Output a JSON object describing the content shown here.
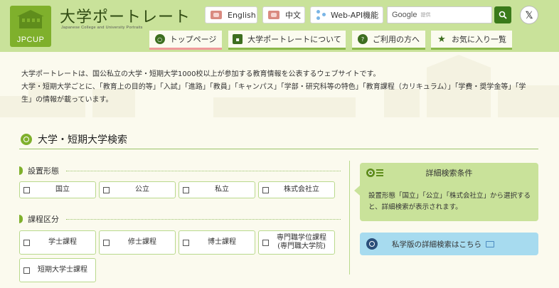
{
  "header": {
    "logo_text": "JPCUP",
    "title": "大学ポートレート",
    "subtitle": "Japanese College and University Portraits",
    "lang_en": "English",
    "lang_zh": "中文",
    "webapi": "Web-API機能",
    "search_brand": "Google",
    "search_placeholder": "提供",
    "x_label": "𝕏"
  },
  "nav": {
    "top": "トップページ",
    "about": "大学ポートレートについて",
    "users": "ご利用の方へ",
    "favorites": "お気に入り一覧"
  },
  "intro": {
    "line1": "大学ポートレートは、国公私立の大学・短期大学1000校以上が参加する教育情報を公表するウェブサイトです。",
    "line2": "大学・短期大学ごとに、「教育上の目的等」「入試」「進路」「教員」「キャンパス」「学部・研究科等の特色」「教育課程（カリキュラム）」「学費・奨学金等」「学生」の情報が載っています。"
  },
  "search": {
    "heading": "大学・短期大学検索",
    "groups": [
      {
        "label": "設置形態",
        "options": [
          "国立",
          "公立",
          "私立",
          "株式会社立"
        ]
      },
      {
        "label": "課程区分",
        "options": [
          "学士課程",
          "修士課程",
          "博士課程",
          "専門職学位課程\n(専門職大学院)",
          "短期大学士課程"
        ]
      }
    ]
  },
  "side": {
    "detail_title": "詳細検索条件",
    "detail_text": "設置形態「国立」「公立」「株式会社立」から選択すると、詳細検索が表示されます。",
    "private_link": "私学版の詳細検索はこちら"
  }
}
